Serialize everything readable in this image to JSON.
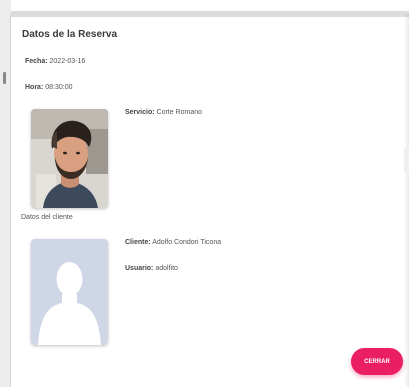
{
  "dialog": {
    "title": "Datos de la Reserva",
    "fecha_label": "Fecha:",
    "fecha_value": "2022-03-16",
    "hora_label": "Hora:",
    "hora_value": "08:30:00",
    "servicio_label": "Servicio:",
    "servicio_value": "Corte Romano",
    "cliente_section": "Datos del cliente",
    "cliente_label": "Cliente:",
    "cliente_value": "Adolfo Condori Ticona",
    "usuario_label": "Usuario:",
    "usuario_value": "adolfito",
    "close_label": "CERRAR"
  },
  "colors": {
    "accent": "#e91e63",
    "avatar_bg": "#cfd6e6"
  },
  "icons": {
    "haircut_photo": "service-photo",
    "avatar": "user-avatar-placeholder"
  }
}
